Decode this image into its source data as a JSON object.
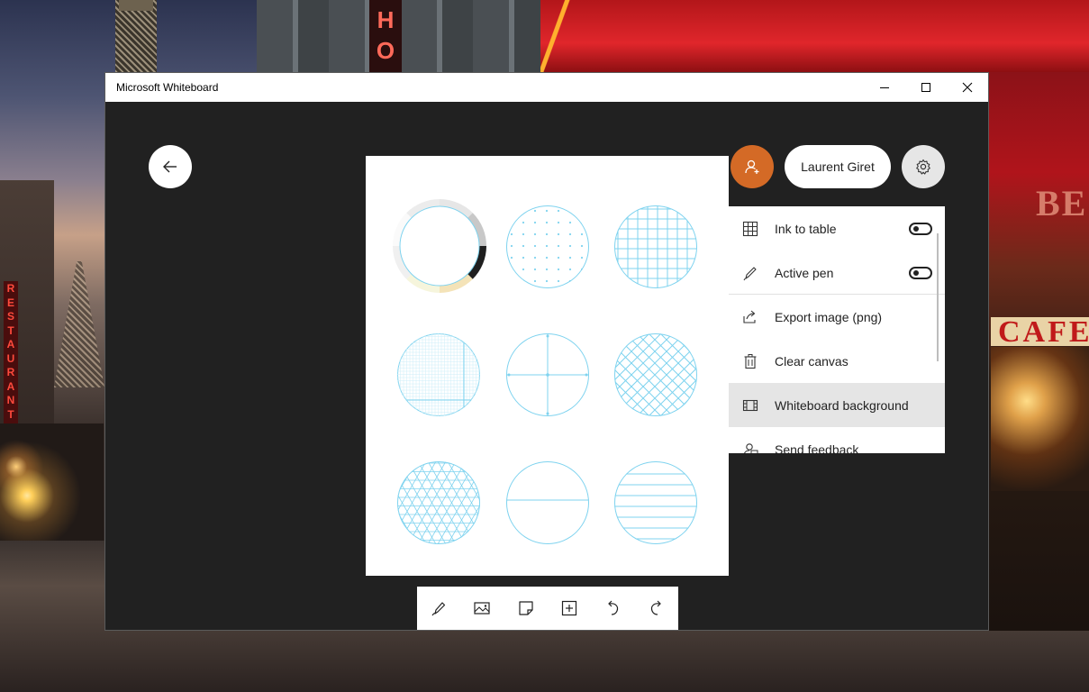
{
  "window": {
    "title": "Microsoft Whiteboard"
  },
  "window_controls": {
    "minimize": "minimize-icon",
    "maximize": "maximize-icon",
    "close": "close-icon"
  },
  "header": {
    "back_icon": "arrow-left-icon",
    "user_name": "Laurent Giret",
    "invite_icon": "add-person-icon",
    "settings_icon": "gear-icon"
  },
  "settings_menu": {
    "items": [
      {
        "label": "Ink to table",
        "icon": "table-icon",
        "toggle": "off"
      },
      {
        "label": "Active pen",
        "icon": "pen-icon",
        "toggle": "off"
      },
      {
        "label": "Export image (png)",
        "icon": "share-icon"
      },
      {
        "label": "Clear canvas",
        "icon": "trash-icon"
      },
      {
        "label": "Whiteboard background",
        "icon": "film-icon",
        "selected": true
      },
      {
        "label": "Send feedback",
        "icon": "feedback-icon"
      }
    ]
  },
  "background_picker": {
    "patterns": [
      "color-ring",
      "dots",
      "square-grid",
      "fine-grid",
      "crosshair",
      "diamond-grid",
      "triangle-grid",
      "single-line",
      "ruled-lines"
    ],
    "colors": [
      "#e6e6e6",
      "#c8c8c8",
      "#1f1f1f",
      "#f4e3b8",
      "#f6f5dc",
      "#f0f0f0",
      "#fafafa",
      "#ececec"
    ],
    "line_color": "#7fd3ef"
  },
  "toolbar": {
    "tools": [
      "pen-icon",
      "image-icon",
      "sticky-note-icon",
      "add-icon",
      "undo-icon",
      "redo-icon"
    ]
  },
  "colors": {
    "accent": "#d46a26",
    "canvas_bg": "#212121",
    "selected_item": "#e5e5e5"
  },
  "wallpaper": {
    "signs": {
      "restaurant": [
        "R",
        "E",
        "S",
        "T",
        "A",
        "U",
        "R",
        "A",
        "N",
        "T"
      ],
      "hotel": [
        "H",
        "O"
      ],
      "cafe": "CAFE",
      "right_top": "BE"
    }
  }
}
